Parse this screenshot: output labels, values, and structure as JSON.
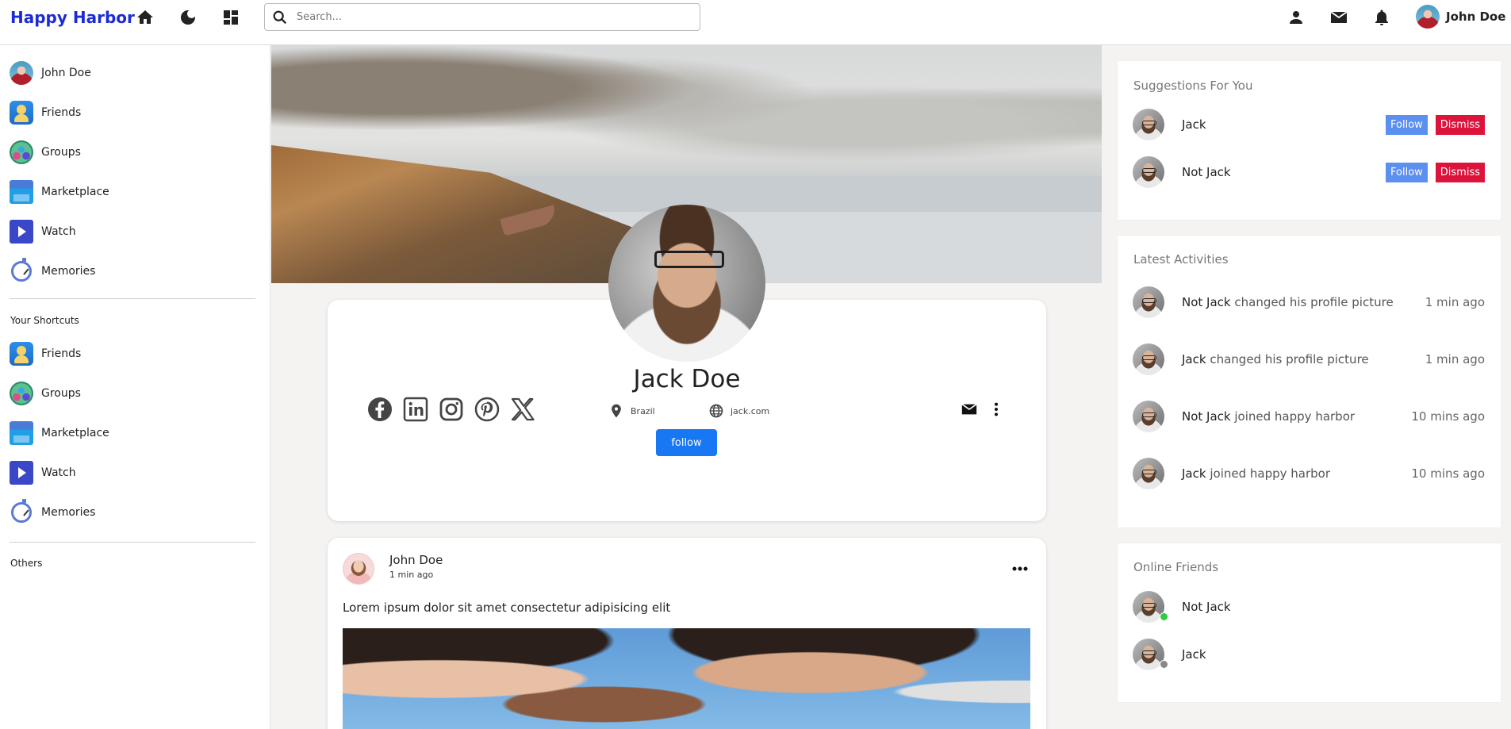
{
  "navbar": {
    "logo": "Happy Harbor",
    "search_placeholder": "Search...",
    "user_name": "John Doe"
  },
  "leftbar": {
    "main_items": [
      {
        "label": "John Doe",
        "icon": "user-avatar"
      },
      {
        "label": "Friends",
        "icon": "friends-icon"
      },
      {
        "label": "Groups",
        "icon": "groups-icon"
      },
      {
        "label": "Marketplace",
        "icon": "marketplace-icon"
      },
      {
        "label": "Watch",
        "icon": "watch-icon"
      },
      {
        "label": "Memories",
        "icon": "memories-icon"
      }
    ],
    "shortcuts_heading": "Your Shortcuts",
    "shortcuts": [
      {
        "label": "Friends",
        "icon": "friends-icon"
      },
      {
        "label": "Groups",
        "icon": "groups-icon"
      },
      {
        "label": "Marketplace",
        "icon": "marketplace-icon"
      },
      {
        "label": "Watch",
        "icon": "watch-icon"
      },
      {
        "label": "Memories",
        "icon": "memories-icon"
      }
    ],
    "others_heading": "Others"
  },
  "profile": {
    "name": "Jack Doe",
    "location": "Brazil",
    "website": "jack.com",
    "follow_label": "follow",
    "socials": [
      "facebook-icon",
      "linkedin-icon",
      "instagram-icon",
      "pinterest-icon",
      "x-icon"
    ]
  },
  "post": {
    "author": "John Doe",
    "time": "1 min ago",
    "text": "Lorem ipsum dolor sit amet consectetur adipisicing elit"
  },
  "suggestions": {
    "title": "Suggestions For You",
    "follow_label": "Follow",
    "dismiss_label": "Dismiss",
    "people": [
      {
        "name": "Jack"
      },
      {
        "name": "Not Jack"
      }
    ]
  },
  "activities": {
    "title": "Latest Activities",
    "items": [
      {
        "name": "Not Jack",
        "action": "changed his profile picture",
        "time": "1 min ago"
      },
      {
        "name": "Jack",
        "action": "changed his profile picture",
        "time": "1 min ago"
      },
      {
        "name": "Not Jack",
        "action": "joined happy harbor",
        "time": "10 mins ago"
      },
      {
        "name": "Jack",
        "action": "joined happy harbor",
        "time": "10 mins ago"
      }
    ]
  },
  "online": {
    "title": "Online Friends",
    "friends": [
      {
        "name": "Not Jack",
        "status": "online",
        "status_color": "#2ecc40"
      },
      {
        "name": "Jack",
        "status": "offline",
        "status_color": "#888888"
      }
    ]
  },
  "colors": {
    "brand": "#1c2bd6",
    "follow_button": "#1877f2",
    "suggest_follow": "#5b8ff0",
    "dismiss": "#dc143c"
  }
}
